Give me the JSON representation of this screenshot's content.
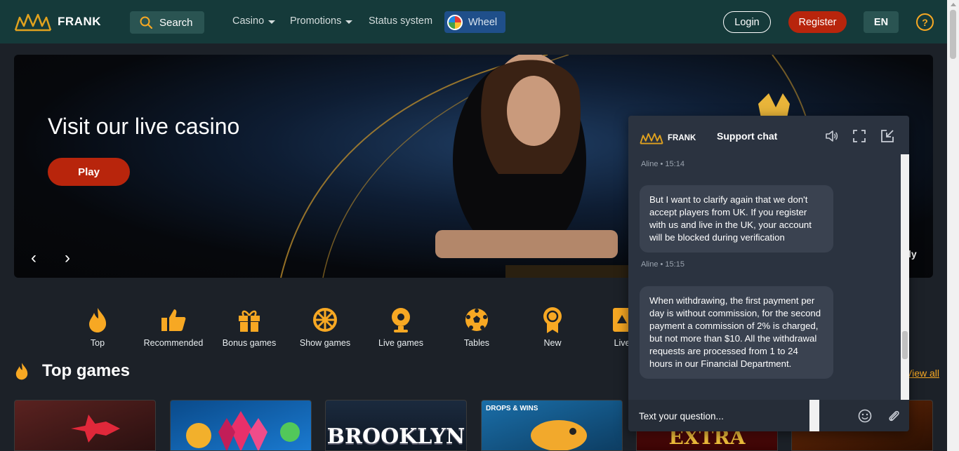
{
  "header": {
    "logo_text": "FRANK",
    "search_label": "Search",
    "nav": [
      {
        "label": "Casino"
      },
      {
        "label": "Promotions"
      },
      {
        "label": "Status system"
      }
    ],
    "wheel_label": "Wheel",
    "login_label": "Login",
    "register_label": "Register",
    "lang_label": "EN",
    "help_label": "?"
  },
  "banner": {
    "title": "Visit our live casino",
    "play_label": "Play",
    "prev_label": "‹",
    "next_label": "›",
    "partial_text": "ly"
  },
  "categories": [
    {
      "label": "Top",
      "icon": "flame-icon"
    },
    {
      "label": "Recommended",
      "icon": "thumbs-up-icon"
    },
    {
      "label": "Bonus games",
      "icon": "gift-icon"
    },
    {
      "label": "Show games",
      "icon": "wheel-icon"
    },
    {
      "label": "Live games",
      "icon": "webcam-icon"
    },
    {
      "label": "Tables",
      "icon": "football-icon"
    },
    {
      "label": "New",
      "icon": "award-icon"
    },
    {
      "label": "Live",
      "icon": "live-icon"
    }
  ],
  "top_games": {
    "title": "Top games",
    "view_all_label": "View all",
    "games": [
      {
        "label": ""
      },
      {
        "label": ""
      },
      {
        "label": "BROOKLYN"
      },
      {
        "label": "DROPS & WINS"
      },
      {
        "label": "EXTRA"
      },
      {
        "label": ""
      }
    ]
  },
  "chat": {
    "logo_text": "FRANK",
    "title": "Support chat",
    "messages": [
      {
        "meta": "Aline • 15:14",
        "text": "But I want to clarify again that we don't accept players from UK. If you register with us and live in the UK, your account will be blocked during verification"
      },
      {
        "meta": "Aline • 15:15",
        "text": "When withdrawing, the first payment per day is without commission, for the second payment a commission of 2% is charged, but not more than $10. All the withdrawal requests are processed from 1 to 24 hours in our Financial Department."
      }
    ],
    "input_placeholder": "Text your question..."
  },
  "colors": {
    "header_bg": "#153a3a",
    "accent_red": "#b8250c",
    "accent_orange": "#f7a823",
    "page_bg": "#1c2128"
  }
}
